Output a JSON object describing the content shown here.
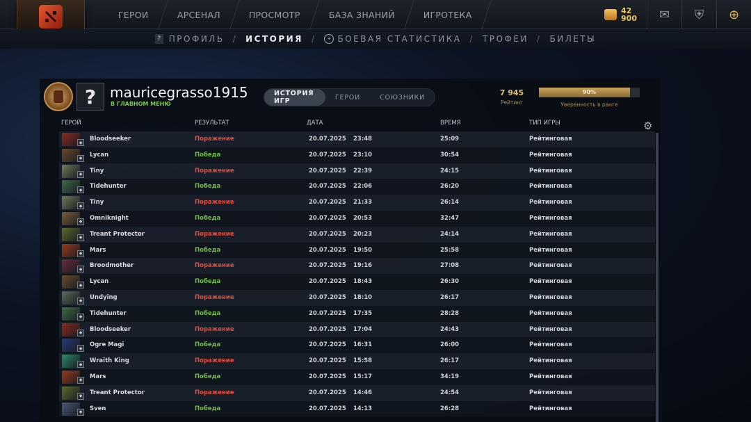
{
  "topnav": {
    "items": [
      "ГЕРОИ",
      "АРСЕНАЛ",
      "ПРОСМОТР",
      "БАЗА ЗНАНИЙ",
      "ИГРОТЕКА"
    ],
    "currency_top": "42",
    "currency_value": "900"
  },
  "subnav": {
    "profile": "ПРОФИЛЬ",
    "history": "ИСТОРИЯ",
    "stats": "БОЕВАЯ СТАТИСТИКА",
    "trophies": "ТРОФЕИ",
    "tickets": "БИЛЕТЫ",
    "separator": "/"
  },
  "profile": {
    "avatar_glyph": "?",
    "username": "mauricegrasso1915",
    "status": "В ГЛАВНОМ МЕНЮ",
    "tabs": [
      "ИСТОРИЯ ИГР",
      "ГЕРОИ",
      "СОЮЗНИКИ"
    ],
    "rating_value": "7 945",
    "rating_label": "Рейтинг",
    "confidence_percent": 90,
    "confidence_text": "90%",
    "confidence_label": "Уверенность в ранге"
  },
  "table": {
    "headers": [
      "ГЕРОЙ",
      "РЕЗУЛЬТАТ",
      "ДАТА",
      "ВРЕМЯ",
      "ТИП ИГРЫ"
    ],
    "rows": [
      {
        "hero": "Bloodseeker",
        "result": "Поражение",
        "win": false,
        "date": "20.07.2025",
        "time": "23:48",
        "duration": "25:09",
        "type": "Рейтинговая",
        "color": "#8a2a1c"
      },
      {
        "hero": "Lycan",
        "result": "Победа",
        "win": true,
        "date": "20.07.2025",
        "time": "23:10",
        "duration": "30:54",
        "type": "Рейтинговая",
        "color": "#6b4a2c"
      },
      {
        "hero": "Tiny",
        "result": "Поражение",
        "win": false,
        "date": "20.07.2025",
        "time": "22:39",
        "duration": "24:15",
        "type": "Рейтинговая",
        "color": "#6e7a5a"
      },
      {
        "hero": "Tidehunter",
        "result": "Победа",
        "win": true,
        "date": "20.07.2025",
        "time": "22:06",
        "duration": "26:20",
        "type": "Рейтинговая",
        "color": "#3e6b4a"
      },
      {
        "hero": "Tiny",
        "result": "Поражение",
        "win": false,
        "date": "20.07.2025",
        "time": "21:33",
        "duration": "26:14",
        "type": "Рейтинговая",
        "color": "#6e7a5a"
      },
      {
        "hero": "Omniknight",
        "result": "Победа",
        "win": true,
        "date": "20.07.2025",
        "time": "20:53",
        "duration": "32:47",
        "type": "Рейтинговая",
        "color": "#7a5c3a"
      },
      {
        "hero": "Treant Protector",
        "result": "Поражение",
        "win": false,
        "date": "20.07.2025",
        "time": "20:23",
        "duration": "24:14",
        "type": "Рейтинговая",
        "color": "#5c6a2a"
      },
      {
        "hero": "Mars",
        "result": "Победа",
        "win": true,
        "date": "20.07.2025",
        "time": "19:50",
        "duration": "25:58",
        "type": "Рейтинговая",
        "color": "#9a3a1a"
      },
      {
        "hero": "Broodmother",
        "result": "Поражение",
        "win": false,
        "date": "20.07.2025",
        "time": "19:16",
        "duration": "27:08",
        "type": "Рейтинговая",
        "color": "#6a2a3a"
      },
      {
        "hero": "Lycan",
        "result": "Победа",
        "win": true,
        "date": "20.07.2025",
        "time": "18:43",
        "duration": "26:30",
        "type": "Рейтинговая",
        "color": "#6b4a2c"
      },
      {
        "hero": "Undying",
        "result": "Поражение",
        "win": false,
        "date": "20.07.2025",
        "time": "18:10",
        "duration": "26:17",
        "type": "Рейтинговая",
        "color": "#5a6a5a"
      },
      {
        "hero": "Tidehunter",
        "result": "Победа",
        "win": true,
        "date": "20.07.2025",
        "time": "17:35",
        "duration": "28:28",
        "type": "Рейтинговая",
        "color": "#3e6b4a"
      },
      {
        "hero": "Bloodseeker",
        "result": "Поражение",
        "win": false,
        "date": "20.07.2025",
        "time": "17:04",
        "duration": "24:43",
        "type": "Рейтинговая",
        "color": "#8a2a1c"
      },
      {
        "hero": "Ogre Magi",
        "result": "Победа",
        "win": true,
        "date": "20.07.2025",
        "time": "16:31",
        "duration": "26:00",
        "type": "Рейтинговая",
        "color": "#2a3a7a"
      },
      {
        "hero": "Wraith King",
        "result": "Поражение",
        "win": false,
        "date": "20.07.2025",
        "time": "15:58",
        "duration": "26:17",
        "type": "Рейтинговая",
        "color": "#2a8a6a"
      },
      {
        "hero": "Mars",
        "result": "Победа",
        "win": true,
        "date": "20.07.2025",
        "time": "15:17",
        "duration": "34:19",
        "type": "Рейтинговая",
        "color": "#9a3a1a"
      },
      {
        "hero": "Treant Protector",
        "result": "Поражение",
        "win": false,
        "date": "20.07.2025",
        "time": "14:46",
        "duration": "24:54",
        "type": "Рейтинговая",
        "color": "#5c6a2a"
      },
      {
        "hero": "Sven",
        "result": "Победа",
        "win": true,
        "date": "20.07.2025",
        "time": "14:13",
        "duration": "26:28",
        "type": "Рейтинговая",
        "color": "#4a5a7a"
      }
    ]
  },
  "colors": {
    "loss": "#e24d3b",
    "win": "#6cc03e",
    "rating_gold": "#e1c073"
  }
}
